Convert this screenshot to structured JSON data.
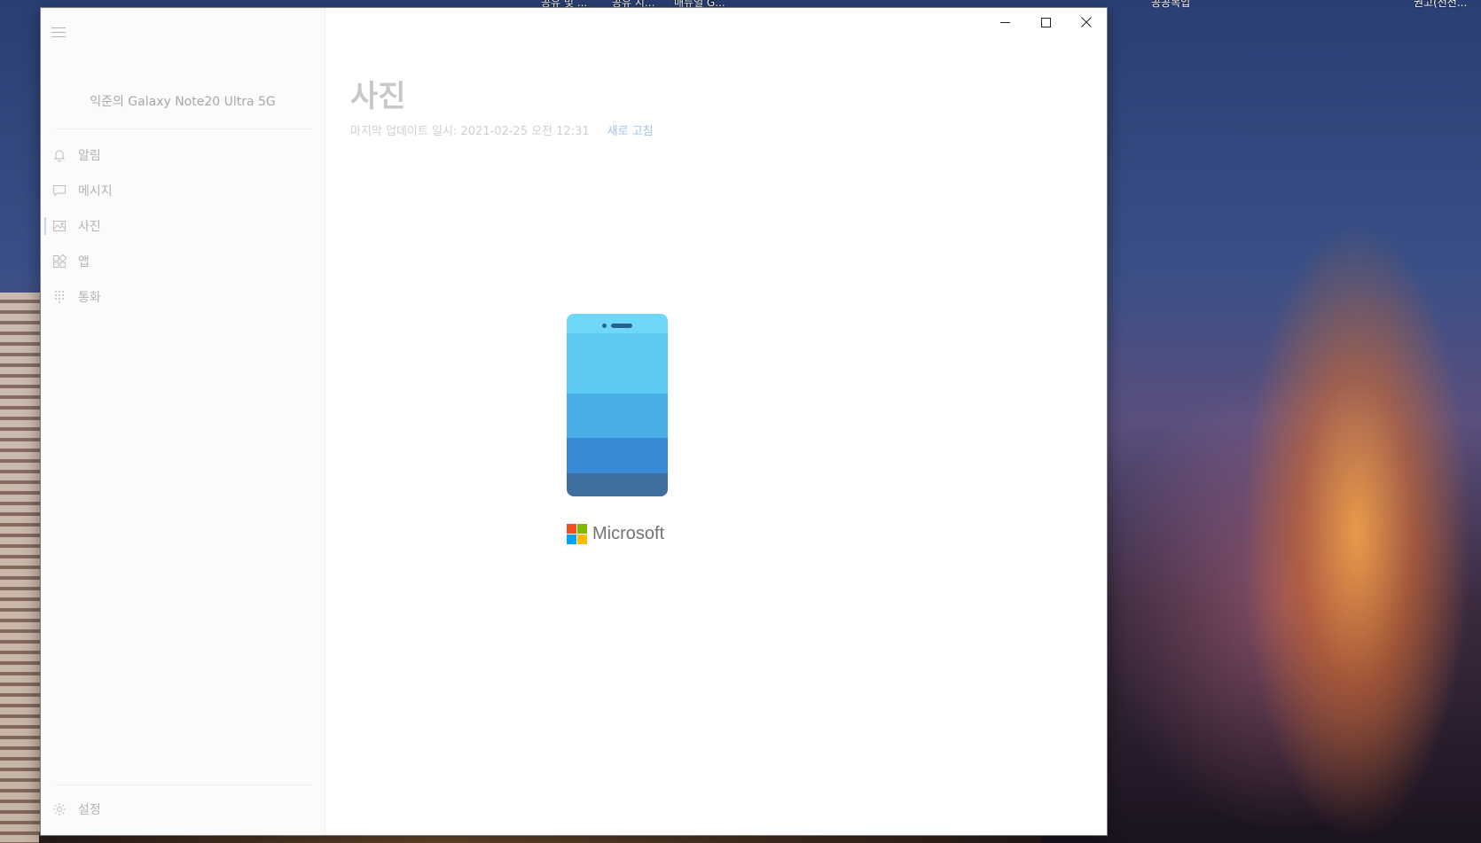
{
  "desktop": {
    "icon_labels": [
      "공유 및 ...",
      "공유 시...",
      "매뉴얼 G...",
      "공공복입",
      "권고(선전..."
    ]
  },
  "window": {
    "controls": {
      "minimize": "minimize-icon",
      "maximize": "maximize-icon",
      "close": "close-icon"
    }
  },
  "sidebar": {
    "device_name": "익준의 Galaxy Note20 Ultra 5G",
    "items": [
      {
        "label": "알림",
        "icon": "bell-icon"
      },
      {
        "label": "메시지",
        "icon": "message-icon"
      },
      {
        "label": "사진",
        "icon": "photo-icon",
        "active": true
      },
      {
        "label": "앱",
        "icon": "apps-icon"
      },
      {
        "label": "통화",
        "icon": "dialpad-icon"
      }
    ],
    "settings_label": "설정"
  },
  "main": {
    "title": "사진",
    "last_updated": "마지막 업데이트 일시: 2021-02-25 오전 12:31",
    "refresh_label": "새로 고침"
  },
  "splash": {
    "brand_text": "Microsoft",
    "phone_colors": [
      "#6fd8f6",
      "#5dcaf2",
      "#4aaee6",
      "#3a8ad6",
      "#3f6f9e"
    ],
    "logo_colors": [
      "#f25022",
      "#7fba00",
      "#00a4ef",
      "#ffb900"
    ]
  }
}
